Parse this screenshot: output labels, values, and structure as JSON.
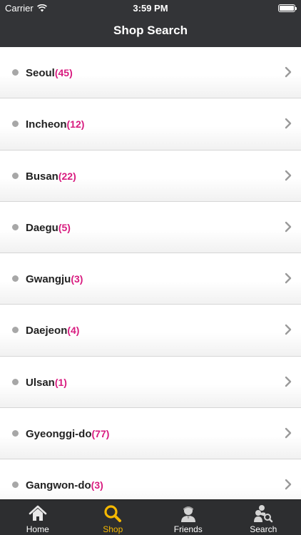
{
  "status_bar": {
    "carrier": "Carrier",
    "time": "3:59 PM"
  },
  "header": {
    "title": "Shop Search"
  },
  "regions": [
    {
      "name": "Seoul",
      "count": "(45)"
    },
    {
      "name": "Incheon",
      "count": "(12)"
    },
    {
      "name": "Busan",
      "count": "(22)"
    },
    {
      "name": "Daegu",
      "count": "(5)"
    },
    {
      "name": "Gwangju",
      "count": "(3)"
    },
    {
      "name": "Daejeon",
      "count": "(4)"
    },
    {
      "name": "Ulsan",
      "count": "(1)"
    },
    {
      "name": "Gyeonggi-do",
      "count": "(77)"
    },
    {
      "name": "Gangwon-do",
      "count": "(3)"
    }
  ],
  "tabs": [
    {
      "label": "Home",
      "icon": "home-icon"
    },
    {
      "label": "Shop",
      "icon": "search-icon",
      "active": true
    },
    {
      "label": "Friends",
      "icon": "friends-icon"
    },
    {
      "label": "Search",
      "icon": "people-search-icon"
    }
  ],
  "colors": {
    "header_bg": "#333437",
    "count_accent": "#d81b7f",
    "active_tab": "#f5b800"
  }
}
